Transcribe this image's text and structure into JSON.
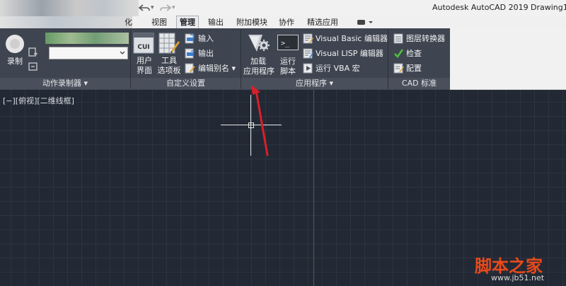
{
  "window": {
    "app_title": "Autodesk AutoCAD 2019",
    "doc_title": "Drawing1"
  },
  "tabs": [
    {
      "label": "化"
    },
    {
      "label": "视图"
    },
    {
      "label": "管理",
      "active": true
    },
    {
      "label": "输出"
    },
    {
      "label": "附加模块"
    },
    {
      "label": "协作"
    },
    {
      "label": "精选应用"
    }
  ],
  "ribbon": {
    "action_recorder": {
      "record_label": "录制",
      "panel_title": "动作录制器 ▾"
    },
    "customize": {
      "user_interface_line1": "用户",
      "user_interface_line2": "界面",
      "tool_palettes_line1": "工具",
      "tool_palettes_line2": "选项板",
      "import_label": "输入",
      "export_label": "输出",
      "edit_alias_label": "编辑别名 ▾",
      "cui_badge": "CUI",
      "panel_title": "自定义设置"
    },
    "applications": {
      "load_app_line1": "加载",
      "load_app_line2": "应用程序",
      "run_script_line1": "运行",
      "run_script_line2": "脚本",
      "vba_editor": "Visual Basic 编辑器",
      "lisp_editor": "Visual LISP 编辑器",
      "run_vba_macro": "运行 VBA 宏",
      "panel_title": "应用程序 ▾"
    },
    "cad_standards": {
      "layer_translator": "图层转换器",
      "check": "检查",
      "configure": "配置",
      "panel_title": "CAD 标准"
    }
  },
  "viewport": {
    "label": "[−][俯视][二维线框]"
  },
  "watermark": {
    "text": "脚本之家",
    "url": "www.jb51.net"
  },
  "colors": {
    "canvas_bg": "#222934",
    "ribbon_dark": "#3f4550",
    "annotation_arrow": "#d8202a"
  }
}
